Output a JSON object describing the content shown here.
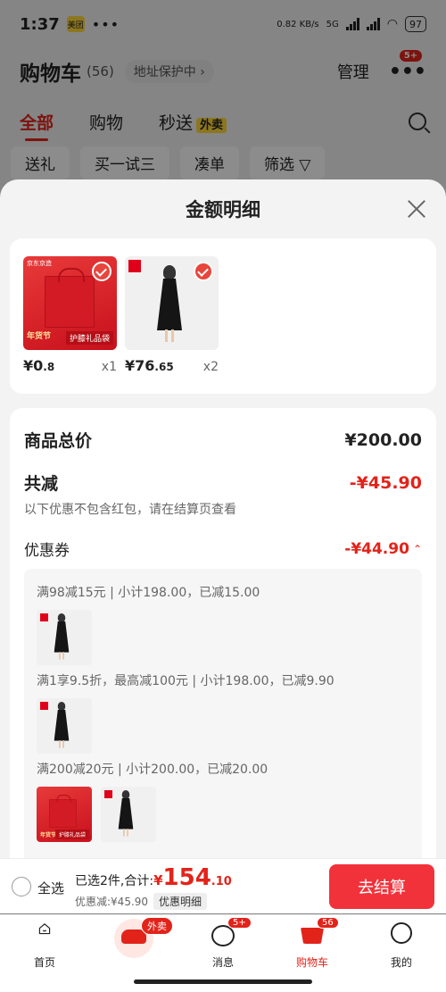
{
  "status_bar": {
    "time": "1:37",
    "app_badge": "美团",
    "dots": "•••",
    "speed": "0.82 KB/s",
    "network": "5G",
    "battery": "97"
  },
  "header": {
    "title": "购物车",
    "count": "(56)",
    "address": "地址保护中 ›",
    "manage": "管理",
    "more_badge": "5+"
  },
  "tabs": [
    {
      "label": "全部"
    },
    {
      "label": "购物"
    },
    {
      "label": "秒送"
    }
  ],
  "tab_waimai": "外卖",
  "filters": [
    "送礼",
    "买一试三",
    "凑单",
    "筛选 ▽"
  ],
  "sheet": {
    "title": "金额明细",
    "products": [
      {
        "price_int": "¥0",
        "price_dec": ".8",
        "qty": "x1",
        "label": "护膝礼品袋",
        "logo": "京东京造",
        "nian": "年货节"
      },
      {
        "price_int": "¥76",
        "price_dec": ".65",
        "qty": "x2"
      }
    ],
    "total_label": "商品总价",
    "total_value": "¥200.00",
    "reduce_label": "共减",
    "reduce_value": "-¥45.90",
    "hint": "以下优惠不包含红包，请在结算页查看",
    "coupon_label": "优惠券",
    "coupon_value": "-¥44.90",
    "coupon_lines": [
      "满98减15元 | 小计198.00，已减15.00",
      "满1享9.5折，最高减100元 | 小计198.00，已减9.90",
      "满200减20元 | 小计200.00，已减20.00"
    ]
  },
  "checkout": {
    "select_all": "全选",
    "selected_text": "已选2件,合计:",
    "currency": "¥",
    "total_int": "154",
    "total_dec": ".10",
    "discount_text": "优惠减:¥45.90",
    "detail_button": "优惠明细",
    "pay_button": "去结算"
  },
  "tabbar": [
    {
      "label": "首页"
    },
    {
      "label": "",
      "badge": "外卖"
    },
    {
      "label": "消息",
      "badge": "5+"
    },
    {
      "label": "购物车",
      "badge": "56"
    },
    {
      "label": "我的"
    }
  ],
  "colors": {
    "accent": "#e2231a",
    "pay": "#f2323b"
  }
}
